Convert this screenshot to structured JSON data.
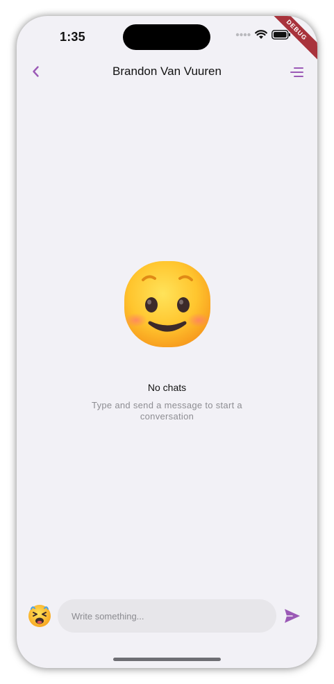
{
  "status_bar": {
    "time": "1:35",
    "icons": [
      "signal-dots-icon",
      "wifi-icon",
      "battery-icon"
    ]
  },
  "debug_banner": "DEBUG",
  "app_bar": {
    "back_icon": "chevron-left-icon",
    "title": "Brandon Van Vuuren",
    "menu_icon": "menu-lines-icon"
  },
  "empty_state": {
    "emoji": "smiling-face-icon",
    "title": "No chats",
    "subtitle": "Type and send a message to start a conversation"
  },
  "composer": {
    "emoji_icon": "emoji-picker-icon",
    "placeholder": "Write something...",
    "value": "",
    "send_icon": "send-icon"
  },
  "colors": {
    "accent": "#9b59b6",
    "background": "#f2f1f6",
    "input_background": "#e7e6ea",
    "secondary_text": "#8d8d92",
    "debug_ribbon": "#a8333c"
  }
}
